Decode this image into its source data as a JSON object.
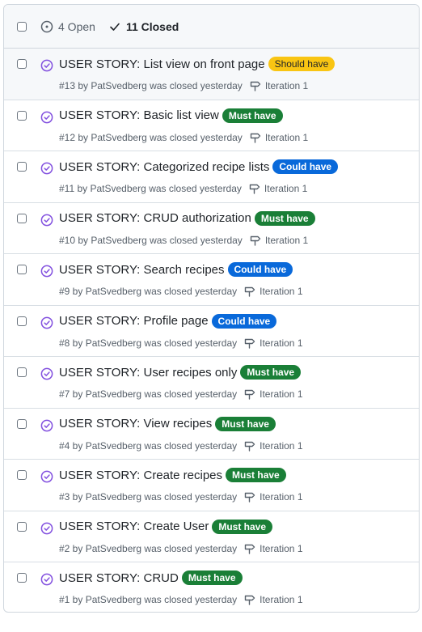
{
  "header": {
    "open_label": "4 Open",
    "closed_label": "11 Closed"
  },
  "colors": {
    "closed_icon": "#8250df",
    "should_have_bg": "#f9c513",
    "should_have_fg": "#1f2328",
    "must_have_bg": "#1a7f37",
    "must_have_fg": "#ffffff",
    "could_have_bg": "#0969da",
    "could_have_fg": "#ffffff"
  },
  "issues": [
    {
      "title": "USER STORY: List view on front page",
      "label": "Should have",
      "label_kind": "should",
      "meta": "#13 by PatSvedberg was closed yesterday",
      "milestone": "Iteration 1"
    },
    {
      "title": "USER STORY: Basic list view",
      "label": "Must have",
      "label_kind": "must",
      "meta": "#12 by PatSvedberg was closed yesterday",
      "milestone": "Iteration 1"
    },
    {
      "title": "USER STORY: Categorized recipe lists",
      "label": "Could have",
      "label_kind": "could",
      "meta": "#11 by PatSvedberg was closed yesterday",
      "milestone": "Iteration 1"
    },
    {
      "title": "USER STORY: CRUD authorization",
      "label": "Must have",
      "label_kind": "must",
      "meta": "#10 by PatSvedberg was closed yesterday",
      "milestone": "Iteration 1"
    },
    {
      "title": "USER STORY: Search recipes",
      "label": "Could have",
      "label_kind": "could",
      "meta": "#9 by PatSvedberg was closed yesterday",
      "milestone": "Iteration 1"
    },
    {
      "title": "USER STORY: Profile page",
      "label": "Could have",
      "label_kind": "could",
      "meta": "#8 by PatSvedberg was closed yesterday",
      "milestone": "Iteration 1"
    },
    {
      "title": "USER STORY: User recipes only",
      "label": "Must have",
      "label_kind": "must",
      "meta": "#7 by PatSvedberg was closed yesterday",
      "milestone": "Iteration 1"
    },
    {
      "title": "USER STORY: View recipes",
      "label": "Must have",
      "label_kind": "must",
      "meta": "#4 by PatSvedberg was closed yesterday",
      "milestone": "Iteration 1"
    },
    {
      "title": "USER STORY: Create recipes",
      "label": "Must have",
      "label_kind": "must",
      "meta": "#3 by PatSvedberg was closed yesterday",
      "milestone": "Iteration 1"
    },
    {
      "title": "USER STORY: Create User",
      "label": "Must have",
      "label_kind": "must",
      "meta": "#2 by PatSvedberg was closed yesterday",
      "milestone": "Iteration 1"
    },
    {
      "title": "USER STORY: CRUD",
      "label": "Must have",
      "label_kind": "must",
      "meta": "#1 by PatSvedberg was closed yesterday",
      "milestone": "Iteration 1"
    }
  ]
}
